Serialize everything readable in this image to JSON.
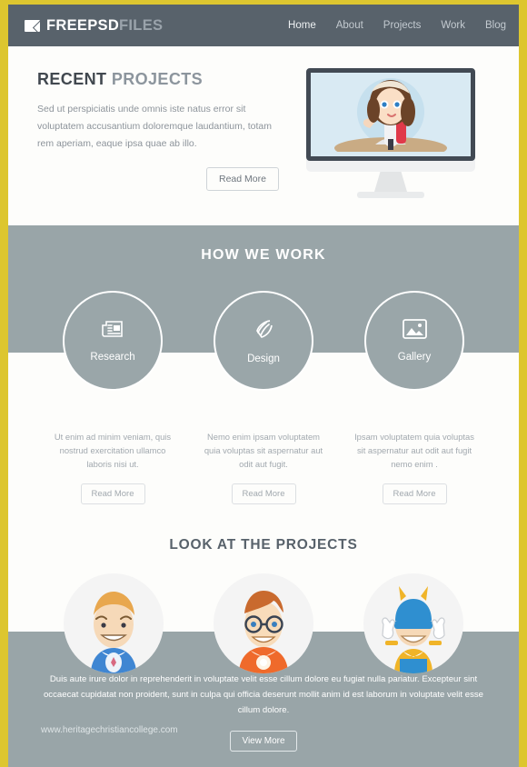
{
  "site": {
    "logo_primary": "FREEPSD",
    "logo_secondary": "FILES",
    "logo_icon": "envelope-icon",
    "watermark": "www.heritagechristiancollege.com",
    "colors": {
      "border_yellow": "#ddc62f",
      "navbar": "#58626b",
      "band_gray": "#99a5a8",
      "page_bg": "#fdfdfb",
      "body_text": "#8d949b",
      "heading_dark": "#41484f"
    }
  },
  "nav": {
    "items": [
      {
        "label": "Home",
        "active": true
      },
      {
        "label": "About",
        "active": false
      },
      {
        "label": "Projects",
        "active": false
      },
      {
        "label": "Work",
        "active": false
      },
      {
        "label": "Blog",
        "active": false
      }
    ]
  },
  "hero": {
    "title_bold": "RECENT",
    "title_light": "PROJECTS",
    "body": "Sed ut perspiciatis unde omnis iste natus error sit voluptatem accusantium doloremque laudantium, totam rem aperiam, eaque ipsa quae ab illo.",
    "button": "Read More",
    "illustration": "desktop-monitor-with-woman-character"
  },
  "work": {
    "heading": "HOW WE WORK",
    "items": [
      {
        "label": "Research",
        "icon": "newspaper-icon",
        "body": "Ut enim ad minim veniam, quis nostrud exercitation ullamco laboris nisi ut.",
        "button": "Read More"
      },
      {
        "label": "Design",
        "icon": "pen-nib-icon",
        "body": "Nemo enim ipsam voluptatem quia voluptas sit aspernatur aut odit aut fugit.",
        "button": "Read More"
      },
      {
        "label": "Gallery",
        "icon": "image-icon",
        "body": "Ipsam voluptatem quia voluptas sit aspernatur aut odit aut fugit nemo enim .",
        "button": "Read More"
      }
    ]
  },
  "projects": {
    "heading": "LOOK AT THE PROJECTS",
    "avatars": [
      {
        "name": "blonde-superhero-blue-suit"
      },
      {
        "name": "redhead-superhero-glasses-orange-suit"
      },
      {
        "name": "blue-yellow-superhero-hands-up"
      }
    ]
  },
  "footer": {
    "body": "Duis aute irure dolor in reprehenderit in voluptate velit esse cillum dolore eu fugiat nulla pariatur. Excepteur sint occaecat cupidatat non proident, sunt in culpa qui officia deserunt mollit anim id est laborum  in voluptate velit esse cillum dolore.",
    "button": "View More"
  }
}
